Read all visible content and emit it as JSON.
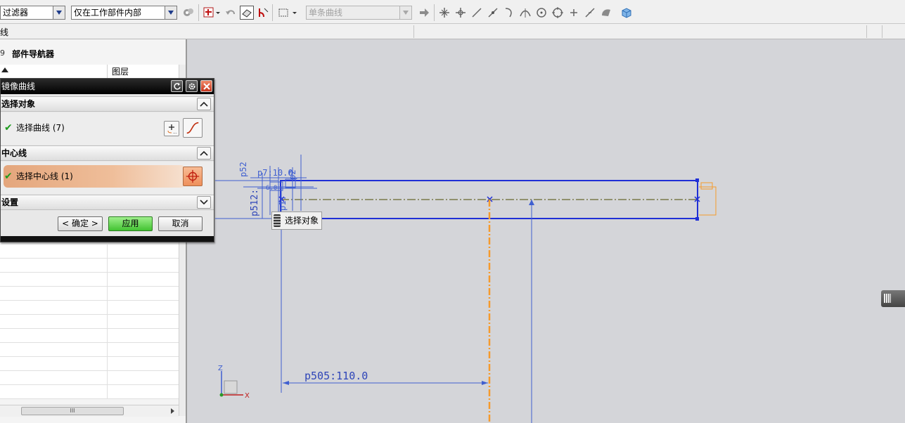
{
  "toolbar": {
    "filter_value": "过滤器",
    "scope_value": "仅在工作部件内部",
    "curve_rule_value": "单条曲线"
  },
  "bar2": {
    "title": "线"
  },
  "navigator": {
    "title": "部件导航器",
    "column_layer": "图层"
  },
  "dialog": {
    "title": "镜像曲线",
    "section_select": "选择对象",
    "item_select_curve": "选择曲线 (7)",
    "section_centerline": "中心线",
    "item_select_centerline": "选择中心线 (1)",
    "section_settings": "设置",
    "btn_ok": "< 确定 >",
    "btn_apply": "应用",
    "btn_cancel": "取消"
  },
  "canvas": {
    "tooltip": "选择对象",
    "dim_horizontal": "p505:110.0",
    "dim_vertical": "p512:",
    "axis_z": "Z",
    "axis_x": "X"
  },
  "colors": {
    "sketch_blue": "#1f2fd6",
    "dimension_blue": "#3f5fd0",
    "centerline_orange": "#f59a2c",
    "dash_olive": "#7a7a4a"
  }
}
